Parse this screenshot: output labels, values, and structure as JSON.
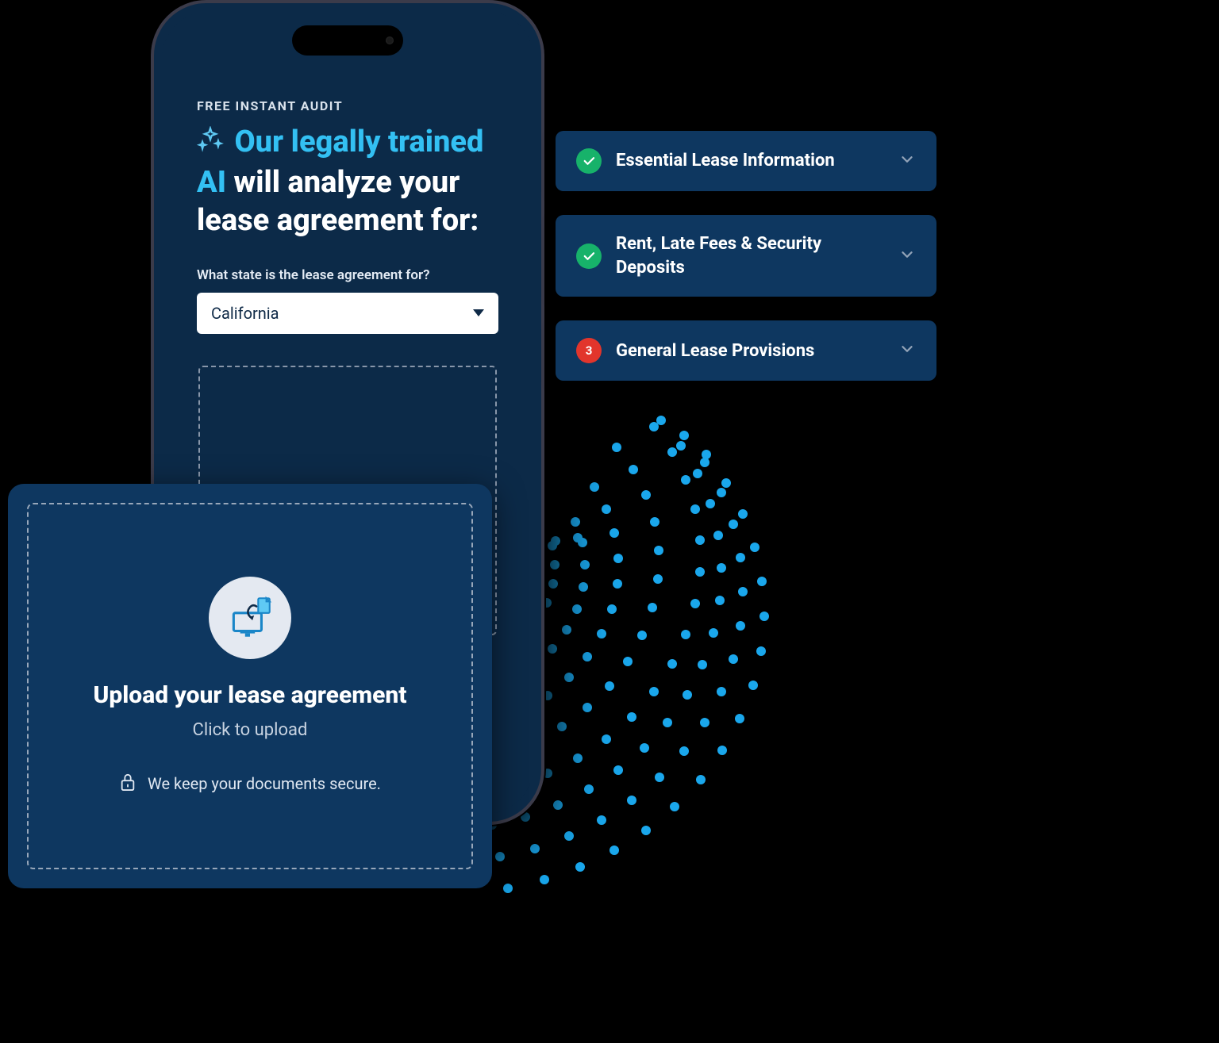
{
  "phone": {
    "eyebrow": "FREE INSTANT AUDIT",
    "headline_parts": {
      "p1": "Our legally trained",
      "p2": "AI",
      "p3": "will analyze your",
      "p4": "lease agreement for:"
    },
    "state_label": "What state is the lease agreement for?",
    "state_value": "California"
  },
  "cards": [
    {
      "status": "ok",
      "title": "Essential Lease Information"
    },
    {
      "status": "ok",
      "title": "Rent, Late Fees & Security Deposits"
    },
    {
      "status": "warn",
      "badge": "3",
      "title": "General Lease Provisions"
    }
  ],
  "upload": {
    "title": "Upload your lease agreement",
    "subtitle": "Click to upload",
    "secure_text": "We keep your documents secure."
  },
  "colors": {
    "navy": "#0e3760",
    "deep_navy": "#0c2a48",
    "cyan": "#33c0f3",
    "green": "#17b26a",
    "red": "#e2352c"
  }
}
